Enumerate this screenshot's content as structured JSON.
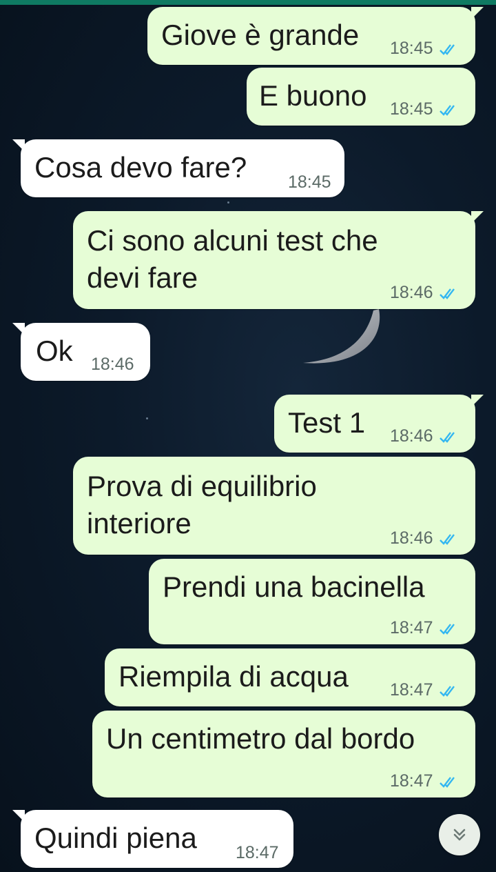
{
  "theme": {
    "outgoing_bubble": "#e6fdd6",
    "incoming_bubble": "#ffffff",
    "read_ticks": "#34b7f1",
    "header_accent": "#0f7a62"
  },
  "messages": [
    {
      "direction": "out",
      "text": "Giove è grande",
      "time": "18:45",
      "status": "read"
    },
    {
      "direction": "out",
      "text": "E buono",
      "time": "18:45",
      "status": "read"
    },
    {
      "direction": "in",
      "text": "Cosa devo fare?",
      "time": "18:45"
    },
    {
      "direction": "out",
      "text_lines": [
        "Ci sono alcuni test che",
        "devi fare"
      ],
      "time": "18:46",
      "status": "read"
    },
    {
      "direction": "in",
      "text": "Ok",
      "time": "18:46"
    },
    {
      "direction": "out",
      "text": "Test 1",
      "time": "18:46",
      "status": "read"
    },
    {
      "direction": "out",
      "text_lines": [
        "Prova di equilibrio",
        "interiore"
      ],
      "time": "18:46",
      "status": "read"
    },
    {
      "direction": "out",
      "text": "Prendi una bacinella",
      "time": "18:47",
      "status": "read"
    },
    {
      "direction": "out",
      "text": "Riempila di acqua",
      "time": "18:47",
      "status": "read"
    },
    {
      "direction": "out",
      "text": "Un centimetro dal bordo",
      "time": "18:47",
      "status": "read"
    },
    {
      "direction": "in",
      "text": "Quindi piena",
      "time": "18:47"
    }
  ],
  "scroll_button": {
    "icon": "double-chevron-down-icon"
  }
}
